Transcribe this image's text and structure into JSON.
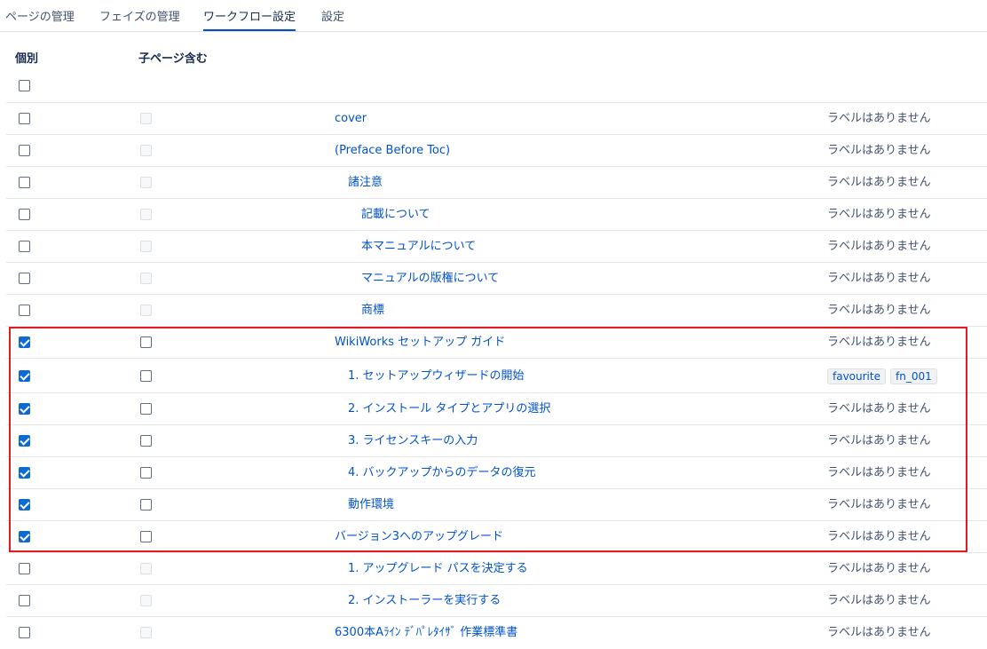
{
  "tabs": [
    {
      "label": "ページの管理",
      "active": false
    },
    {
      "label": "フェイズの管理",
      "active": false
    },
    {
      "label": "ワークフロー設定",
      "active": true
    },
    {
      "label": "設定",
      "active": false
    }
  ],
  "headers": {
    "individual": "個別",
    "include_children": "子ページ含む"
  },
  "no_label_text": "ラベルはありません",
  "rows": [
    {
      "title": "cover",
      "indent": 0,
      "individual": false,
      "children": false,
      "children_disabled": true,
      "labels": []
    },
    {
      "title": "(Preface Before Toc)",
      "indent": 0,
      "individual": false,
      "children": false,
      "children_disabled": true,
      "labels": []
    },
    {
      "title": "諸注意",
      "indent": 1,
      "individual": false,
      "children": false,
      "children_disabled": true,
      "labels": []
    },
    {
      "title": "記載について",
      "indent": 2,
      "individual": false,
      "children": false,
      "children_disabled": true,
      "labels": []
    },
    {
      "title": "本マニュアルについて",
      "indent": 2,
      "individual": false,
      "children": false,
      "children_disabled": true,
      "labels": []
    },
    {
      "title": "マニュアルの版権について",
      "indent": 2,
      "individual": false,
      "children": false,
      "children_disabled": true,
      "labels": []
    },
    {
      "title": "商標",
      "indent": 2,
      "individual": false,
      "children": false,
      "children_disabled": true,
      "labels": []
    },
    {
      "title": "WikiWorks セットアップ ガイド",
      "indent": 0,
      "individual": true,
      "children": false,
      "children_disabled": false,
      "labels": []
    },
    {
      "title": "1. セットアップウィザードの開始",
      "indent": 1,
      "individual": true,
      "children": false,
      "children_disabled": false,
      "labels": [
        "favourite",
        "fn_001"
      ]
    },
    {
      "title": "2. インストール タイプとアプリの選択",
      "indent": 1,
      "individual": true,
      "children": false,
      "children_disabled": false,
      "labels": []
    },
    {
      "title": "3. ライセンスキーの入力",
      "indent": 1,
      "individual": true,
      "children": false,
      "children_disabled": false,
      "labels": []
    },
    {
      "title": "4. バックアップからのデータの復元",
      "indent": 1,
      "individual": true,
      "children": false,
      "children_disabled": false,
      "labels": []
    },
    {
      "title": "動作環境",
      "indent": 1,
      "individual": true,
      "children": false,
      "children_disabled": false,
      "labels": []
    },
    {
      "title": "バージョン3へのアップグレード",
      "indent": 0,
      "individual": true,
      "children": false,
      "children_disabled": false,
      "labels": []
    },
    {
      "title": "1. アップグレード パスを決定する",
      "indent": 1,
      "individual": false,
      "children": false,
      "children_disabled": true,
      "labels": []
    },
    {
      "title": "2. インストーラーを実行する",
      "indent": 1,
      "individual": false,
      "children": false,
      "children_disabled": true,
      "labels": []
    },
    {
      "title": "6300本Aﾗｲﾝ ﾃﾞﾊﾟﾚﾀｲｻﾞ 作業標準書",
      "indent": 0,
      "individual": false,
      "children": false,
      "children_disabled": true,
      "labels": []
    }
  ],
  "colors": {
    "link": "#0052cc",
    "checkbox_checked": "#0b6bd3",
    "highlight_border": "#e01b24",
    "tab_underline": "#0052cc"
  }
}
